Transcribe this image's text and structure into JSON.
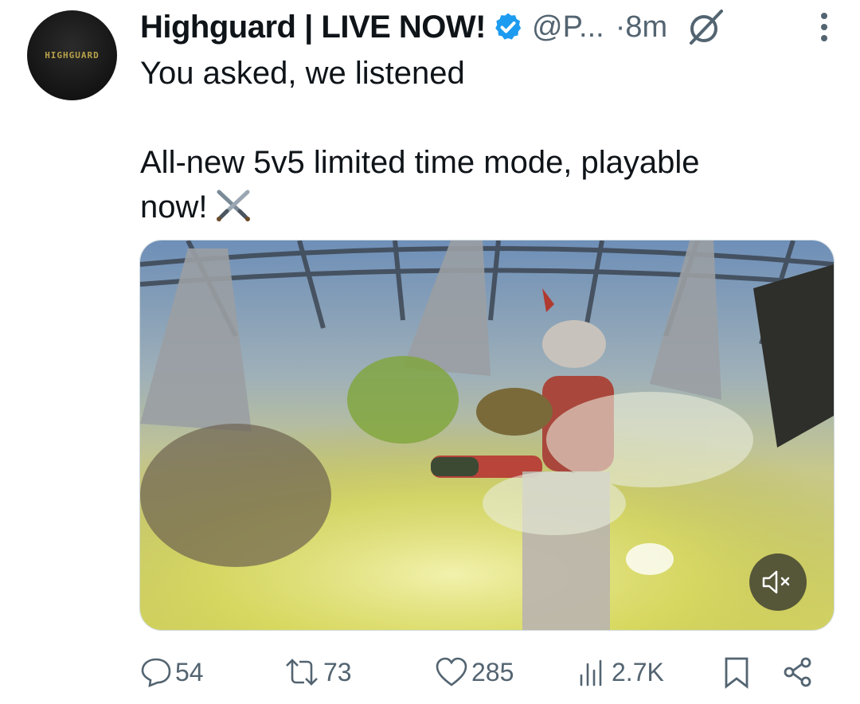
{
  "post": {
    "avatar_text": "HIGHGUARD",
    "display_name": "Highguard | LIVE NOW!",
    "handle": "@P...",
    "time": "·8m",
    "text": "You asked, we listened\n\nAll-new 5v5 limited time mode, playable\nnow!",
    "emoji": "crossed-swords-icon",
    "verified_color": "#1d9bf0"
  },
  "media": {
    "type": "video",
    "description_icon": "mute-icon"
  },
  "actions": {
    "replies": "54",
    "reposts": "73",
    "likes": "285",
    "views": "2.7K"
  },
  "colors": {
    "text": "#0f1419",
    "secondary": "#536471"
  }
}
